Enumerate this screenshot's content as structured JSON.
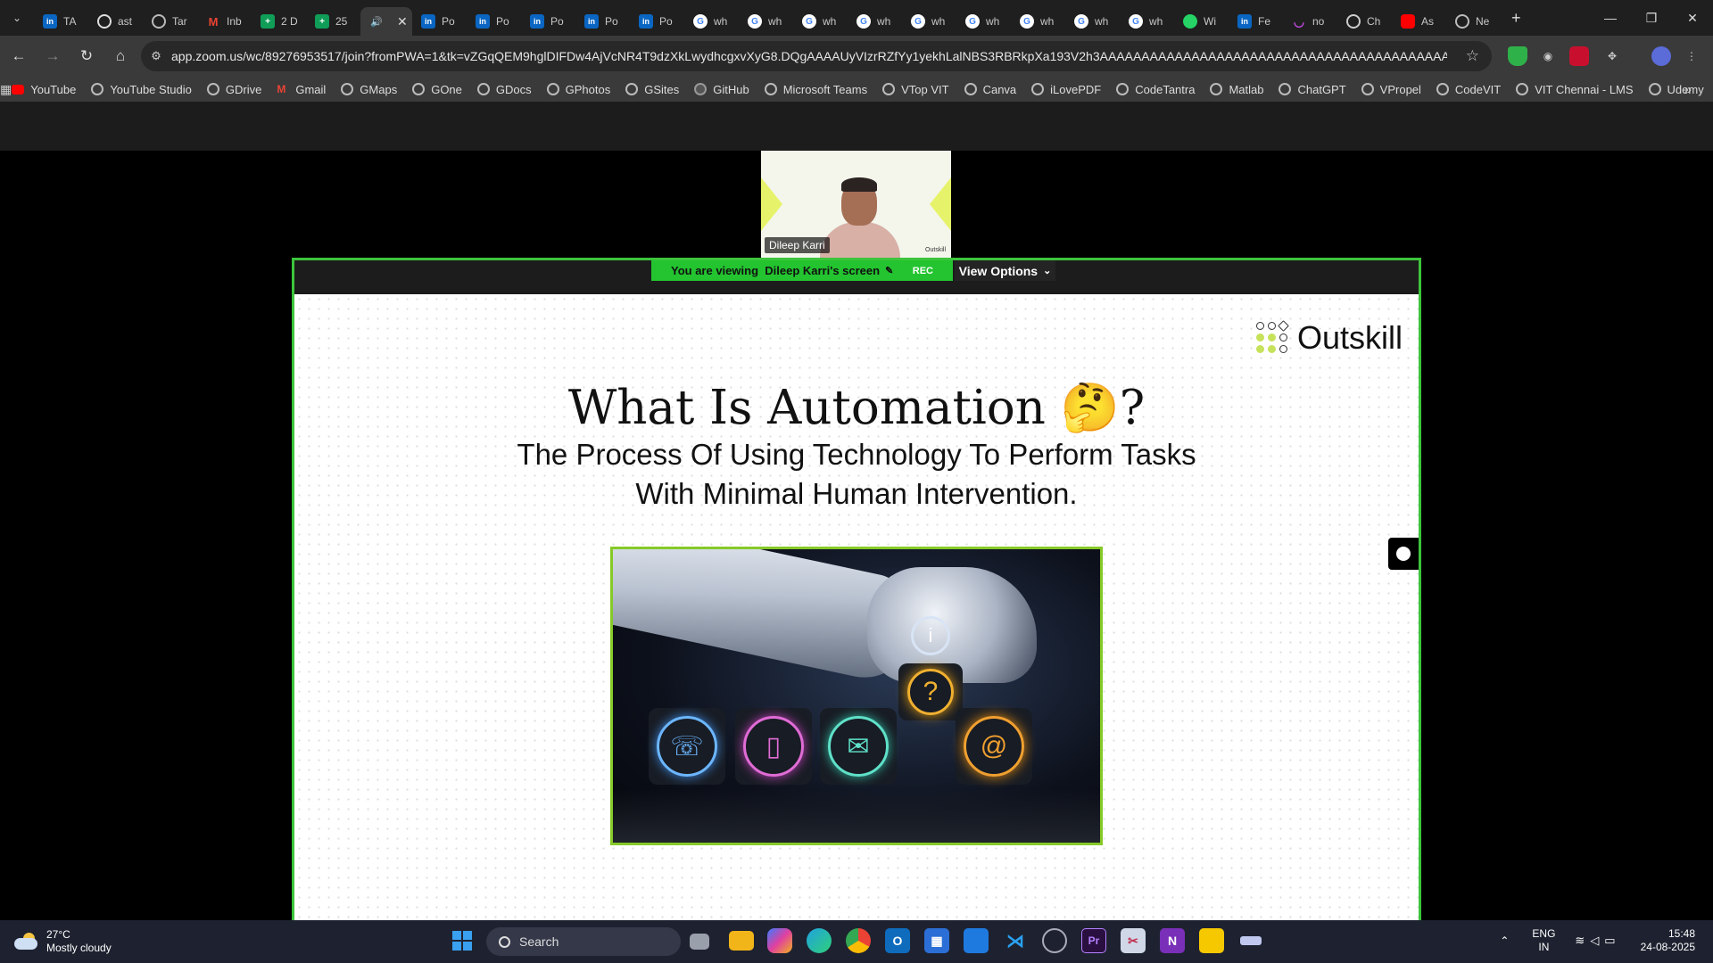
{
  "browser": {
    "tabs": [
      {
        "label": "TA",
        "icon": "linkedin-icon"
      },
      {
        "label": "ast",
        "icon": "github-icon"
      },
      {
        "label": "Tar",
        "icon": "globe-icon"
      },
      {
        "label": "Inb",
        "icon": "gmail-icon"
      },
      {
        "label": "2 D",
        "icon": "sheets-icon"
      },
      {
        "label": "25",
        "icon": "sheets-icon"
      },
      {
        "label": "",
        "icon": "speaker-icon",
        "active": true
      },
      {
        "label": "Po",
        "icon": "linkedin-icon"
      },
      {
        "label": "Po",
        "icon": "linkedin-icon"
      },
      {
        "label": "Po",
        "icon": "linkedin-icon"
      },
      {
        "label": "Po",
        "icon": "linkedin-icon"
      },
      {
        "label": "Po",
        "icon": "linkedin-icon"
      },
      {
        "label": "wh",
        "icon": "google-icon"
      },
      {
        "label": "wh",
        "icon": "google-icon"
      },
      {
        "label": "wh",
        "icon": "google-icon"
      },
      {
        "label": "wh",
        "icon": "google-icon"
      },
      {
        "label": "wh",
        "icon": "google-icon"
      },
      {
        "label": "wh",
        "icon": "google-icon"
      },
      {
        "label": "wh",
        "icon": "google-icon"
      },
      {
        "label": "wh",
        "icon": "google-icon"
      },
      {
        "label": "wh",
        "icon": "google-icon"
      },
      {
        "label": "Wi",
        "icon": "whatsapp-icon"
      },
      {
        "label": "Fe",
        "icon": "linkedin-icon"
      },
      {
        "label": "no",
        "icon": "purple-icon"
      },
      {
        "label": "Ch",
        "icon": "chatgpt-icon"
      },
      {
        "label": "As",
        "icon": "youtube-icon"
      },
      {
        "label": "Ne",
        "icon": "globe-icon"
      }
    ],
    "url": "app.zoom.us/wc/89276953517/join?fromPWA=1&tk=vZGqQEM9hglDIFDw4AjVcNR4T9dzXkLwydhcgxvXyG8.DQgAAAAUyVIzrRZfYy1yekhLalNBS3RBRkpXa193V2h3AAAAAAAAAAAAAAAAAAAAAAAAAAAAAAAAAAAAAAAAAA&_x_zm_r..."
  },
  "bookmarks": [
    {
      "label": "YouTube",
      "icon": "youtube-icon"
    },
    {
      "label": "YouTube Studio",
      "icon": "globe-icon"
    },
    {
      "label": "GDrive",
      "icon": "globe-icon"
    },
    {
      "label": "Gmail",
      "icon": "gmail-icon"
    },
    {
      "label": "GMaps",
      "icon": "globe-icon"
    },
    {
      "label": "GOne",
      "icon": "globe-icon"
    },
    {
      "label": "GDocs",
      "icon": "globe-icon"
    },
    {
      "label": "GPhotos",
      "icon": "globe-icon"
    },
    {
      "label": "GSites",
      "icon": "globe-icon"
    },
    {
      "label": "GitHub",
      "icon": "github-icon"
    },
    {
      "label": "Microsoft Teams",
      "icon": "globe-icon"
    },
    {
      "label": "VTop VIT",
      "icon": "globe-icon"
    },
    {
      "label": "Canva",
      "icon": "globe-icon"
    },
    {
      "label": "iLovePDF",
      "icon": "globe-icon"
    },
    {
      "label": "CodeTantra",
      "icon": "globe-icon"
    },
    {
      "label": "Matlab",
      "icon": "globe-icon"
    },
    {
      "label": "ChatGPT",
      "icon": "chatgpt-icon"
    },
    {
      "label": "VPropel",
      "icon": "globe-icon"
    },
    {
      "label": "CodeVIT",
      "icon": "globe-icon"
    },
    {
      "label": "VIT Chennai - LMS",
      "icon": "globe-icon"
    },
    {
      "label": "Udemy",
      "icon": "globe-icon"
    }
  ],
  "zoom": {
    "participant_name": "Dileep Karri",
    "tile_brand": "Outskill",
    "viewing_prefix": "You are viewing",
    "viewing_name": "Dileep Karri's screen",
    "rec_label": "REC",
    "view_options_label": "View Options"
  },
  "slide": {
    "logo_text": "Outskill",
    "title": "What Is Automation 🤔?",
    "subtitle_line1": "The Process Of Using Technology To Perform Tasks",
    "subtitle_line2": "With Minimal Human Intervention.",
    "accent_green": "#c6e25a",
    "image_icons": [
      "phone-icon",
      "smartphone-icon",
      "mail-icon",
      "info-icon",
      "question-icon",
      "at-sign-icon"
    ]
  },
  "taskbar": {
    "temperature": "27°C",
    "weather": "Mostly cloudy",
    "search_placeholder": "Search",
    "lang_line1": "ENG",
    "lang_line2": "IN",
    "time": "15:48",
    "date": "24-08-2025"
  },
  "colors": {
    "share_border": "#3cc43c",
    "viewing_pill": "#23c42f"
  }
}
